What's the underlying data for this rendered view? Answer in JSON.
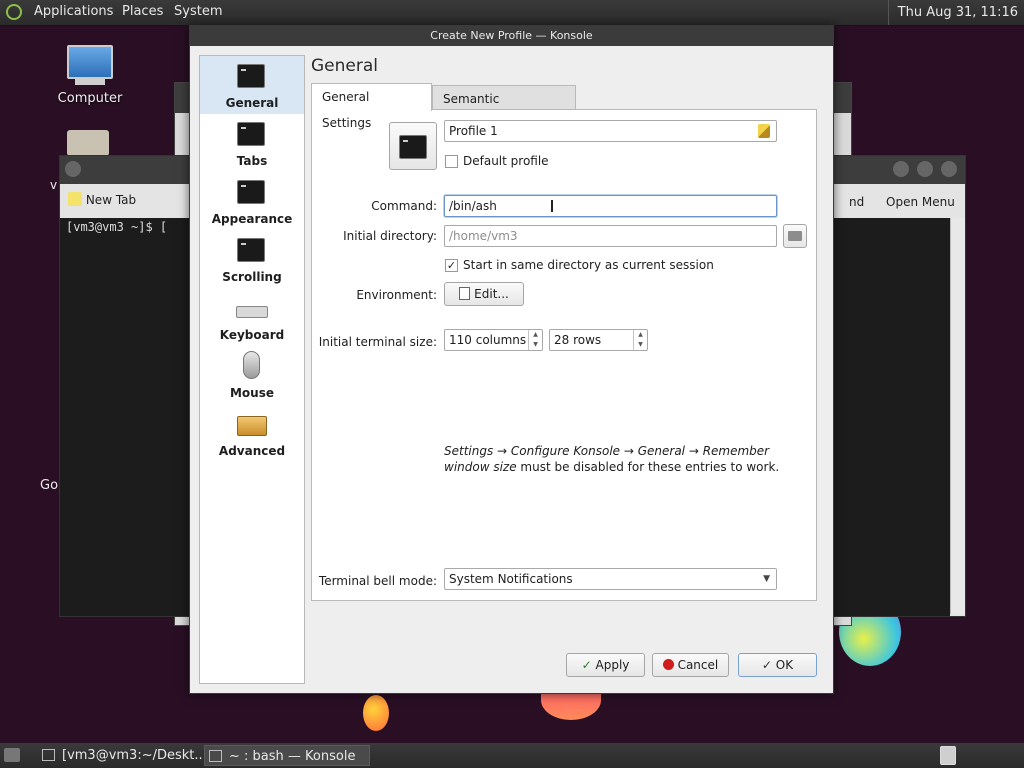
{
  "top_panel": {
    "menus": [
      "Applications",
      "Places",
      "System"
    ],
    "clock": "Thu Aug 31, 11:16"
  },
  "desktop": {
    "icons": [
      "Computer"
    ],
    "partial_labels": [
      "v",
      "Go"
    ]
  },
  "background_terminal": {
    "new_tab": "New Tab",
    "prompt": "[vm3@vm3 ~]$ [",
    "right_labels": [
      "nd",
      "Open Menu"
    ]
  },
  "dialog": {
    "title": "Create New Profile — Konsole",
    "page_heading": "General",
    "sidebar": [
      {
        "label": "General",
        "icon": "terminal-icon",
        "active": true
      },
      {
        "label": "Tabs",
        "icon": "terminal-icon"
      },
      {
        "label": "Appearance",
        "icon": "terminal-icon"
      },
      {
        "label": "Scrolling",
        "icon": "terminal-icon"
      },
      {
        "label": "Keyboard",
        "icon": "keyboard-icon"
      },
      {
        "label": "Mouse",
        "icon": "mouse-icon"
      },
      {
        "label": "Advanced",
        "icon": "toolbox-icon"
      }
    ],
    "tabs": [
      "General Settings",
      "Semantic Integration"
    ],
    "profile_name": "Profile 1",
    "default_profile_label": "Default profile",
    "command_label": "Command:",
    "command_value": "/bin/ash",
    "initial_dir_label": "Initial directory:",
    "initial_dir_placeholder": "/home/vm3",
    "same_dir_label": "Start in same directory as current session",
    "environment_label": "Environment:",
    "edit_button": "Edit...",
    "terminal_size_label": "Initial terminal size:",
    "columns_value": "110 columns",
    "rows_value": "28 rows",
    "note_italic": "Settings → Configure Konsole → General → Remember window size",
    "note_plain": " must be disabled for these entries to work.",
    "bell_label": "Terminal bell mode:",
    "bell_value": "System Notifications",
    "apply_button": "Apply",
    "cancel_button": "Cancel",
    "ok_button": "OK"
  },
  "taskbar": {
    "items": [
      "[vm3@vm3:~/Deskt...",
      "~ : bash — Konsole"
    ]
  }
}
